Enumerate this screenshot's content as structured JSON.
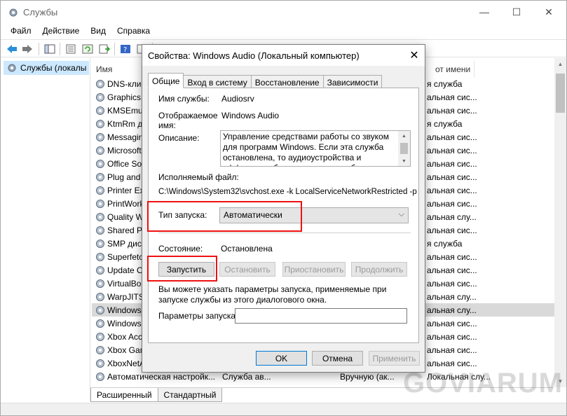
{
  "main": {
    "title": "Службы",
    "menu": [
      "Файл",
      "Действие",
      "Вид",
      "Справка"
    ],
    "tree_item": "Службы (локалы",
    "columns": {
      "name": "Имя",
      "logon": "от имени"
    },
    "rows": [
      {
        "name": "DNS-клиент",
        "desc": "",
        "startup": "",
        "logon": "я служба"
      },
      {
        "name": "GraphicsPerfSvc",
        "desc": "",
        "startup": "",
        "logon": "альная сис..."
      },
      {
        "name": "KMSEmulator",
        "desc": "",
        "startup": "",
        "logon": "альная сис..."
      },
      {
        "name": "KtmRm для координатора",
        "desc": "",
        "startup": "",
        "logon": "я служба"
      },
      {
        "name": "MessagingService",
        "desc": "",
        "startup": "",
        "logon": "альная сис..."
      },
      {
        "name": "Microsoft Software Shadow",
        "desc": "",
        "startup": "",
        "logon": "альная сис..."
      },
      {
        "name": "Office Source Engine",
        "desc": "",
        "startup": "",
        "logon": "альная сис..."
      },
      {
        "name": "Plug and Play",
        "desc": "",
        "startup": "",
        "logon": "альная сис..."
      },
      {
        "name": "Printer Extensions",
        "desc": "",
        "startup": "",
        "logon": "альная сис..."
      },
      {
        "name": "PrintWorkflow",
        "desc": "",
        "startup": "",
        "logon": "альная сис..."
      },
      {
        "name": "Quality Windows Audio",
        "desc": "",
        "startup": "",
        "logon": "альная слу..."
      },
      {
        "name": "Shared PC Account Manager",
        "desc": "",
        "startup": "",
        "logon": "альная сис..."
      },
      {
        "name": "SMP дисковых пространств",
        "desc": "",
        "startup": "",
        "logon": "я служба"
      },
      {
        "name": "Superfetch",
        "desc": "",
        "startup": "",
        "logon": "альная сис..."
      },
      {
        "name": "Update Orchestrator Service",
        "desc": "",
        "startup": "",
        "logon": "альная сис..."
      },
      {
        "name": "VirtualBox Guest Additions",
        "desc": "",
        "startup": "",
        "logon": "альная сис..."
      },
      {
        "name": "WarpJITSvc",
        "desc": "",
        "startup": "",
        "logon": "альная слу..."
      },
      {
        "name": "Windows Audio",
        "desc": "",
        "startup": "",
        "logon": "альная слу..."
      },
      {
        "name": "Windows Audio Endpoint",
        "desc": "",
        "startup": "",
        "logon": "альная сис..."
      },
      {
        "name": "Xbox Accessory Management",
        "desc": "",
        "startup": "",
        "logon": "альная сис..."
      },
      {
        "name": "Xbox Game Monitoring",
        "desc": "",
        "startup": "",
        "logon": "альная сис..."
      },
      {
        "name": "XboxNetApiSvc",
        "desc": "",
        "startup": "",
        "logon": "альная сис..."
      },
      {
        "name": "Автоматическая настройк...",
        "desc": "Служба ав...",
        "startup": "Вручную (ак...",
        "logon": "Локальная слу..."
      }
    ],
    "bottom_tabs": [
      "Расширенный",
      "Стандартный"
    ],
    "watermark": "GOVIARUM"
  },
  "dialog": {
    "title": "Свойства: Windows Audio (Локальный компьютер)",
    "tabs": [
      "Общие",
      "Вход в систему",
      "Восстановление",
      "Зависимости"
    ],
    "service_name_label": "Имя службы:",
    "service_name_value": "Audiosrv",
    "display_name_label": "Отображаемое имя:",
    "display_name_value": "Windows Audio",
    "description_label": "Описание:",
    "description_value": "Управление средствами работы со звуком для программ Windows.  Если эта служба остановлена, то аудиоустройства и эффекты не будут правильно работать.  Если данная служба",
    "exe_label": "Исполняемый файл:",
    "exe_value": "C:\\Windows\\System32\\svchost.exe -k LocalServiceNetworkRestricted -p",
    "startup_type_label": "Тип запуска:",
    "startup_type_value": "Автоматически",
    "status_label": "Состояние:",
    "status_value": "Остановлена",
    "btn_start": "Запустить",
    "btn_stop": "Остановить",
    "btn_pause": "Приостановить",
    "btn_resume": "Продолжить",
    "hint_text": "Вы можете указать параметры запуска, применяемые при запуске службы из этого диалогового окна.",
    "params_label": "Параметры запуска:",
    "params_value": "",
    "btn_ok": "OK",
    "btn_cancel": "Отмена",
    "btn_apply": "Применить"
  },
  "colors": {
    "highlight": "#e11111",
    "tree_selected": "#cce8ff",
    "dialog_bg": "#f0f0f0"
  }
}
